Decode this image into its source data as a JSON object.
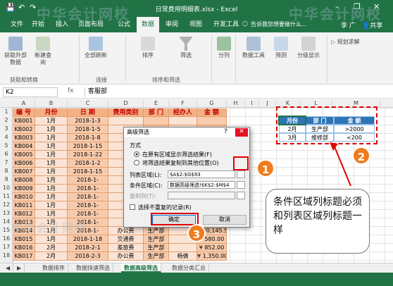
{
  "window": {
    "title": "日常费用明细表.xlsx - Excel",
    "minimize": "–",
    "restore": "❐",
    "close": "✕"
  },
  "menubar": {
    "tabs": [
      "文件",
      "开始",
      "插入",
      "页面布局",
      "公式",
      "数据",
      "审阅",
      "视图",
      "开发工具"
    ],
    "active": "数据",
    "tell_me": "告诉我您想要做什么...",
    "user": "李 广",
    "share": "共享"
  },
  "ribbon": {
    "groups": [
      {
        "label": "获取和转换",
        "buttons": [
          "获取外部数据",
          "新建查询"
        ]
      },
      {
        "label": "连接",
        "buttons": [
          "全部刷新"
        ]
      },
      {
        "label": "排序和筛选",
        "buttons": [
          "排序",
          "筛选"
        ]
      },
      {
        "label": "",
        "buttons": [
          "分列"
        ]
      },
      {
        "label": "",
        "buttons": [
          "数据工具",
          "预测",
          "分级显示"
        ]
      }
    ],
    "planning": "规划求解"
  },
  "formula": {
    "name_box": "K2",
    "fx": "fx",
    "value": "客服部"
  },
  "columns": [
    "A",
    "B",
    "C",
    "D",
    "E",
    "F",
    "G",
    "H",
    "I",
    "J",
    "K",
    "L",
    "M"
  ],
  "rows": [
    "1",
    "2",
    "3",
    "4",
    "5",
    "6",
    "7",
    "8",
    "9",
    "10",
    "11",
    "12",
    "13",
    "14",
    "15",
    "16",
    "17",
    "18"
  ],
  "table": {
    "headers": [
      "编 号",
      "月份",
      "日 期",
      "费用类别",
      "部 门",
      "经办人",
      "金 额"
    ],
    "rows": [
      [
        "KB001",
        "1月",
        "2018-1-3",
        "",
        "",
        "",
        ""
      ],
      [
        "KB002",
        "1月",
        "2018-1-5",
        "",
        "",
        "",
        ""
      ],
      [
        "KB003",
        "1月",
        "2018-1-8",
        "",
        "",
        "",
        ""
      ],
      [
        "KB004",
        "1月",
        "2018-1-15",
        "",
        "",
        "",
        ""
      ],
      [
        "KB005",
        "1月",
        "2018-1-22",
        "",
        "",
        "",
        ""
      ],
      [
        "KB006",
        "1月",
        "2018-1-2",
        "",
        "",
        "",
        ""
      ],
      [
        "KB007",
        "1月",
        "2018-1-15",
        "",
        "",
        "",
        ""
      ],
      [
        "KB008",
        "1月",
        "2018-1-",
        "",
        "",
        "",
        ""
      ],
      [
        "KB009",
        "1月",
        "2018-1-",
        "",
        "",
        "",
        ""
      ],
      [
        "KB010",
        "1月",
        "2018-1-",
        "",
        "",
        "",
        ""
      ],
      [
        "KB011",
        "1月",
        "2018-1-",
        "",
        "",
        "",
        ""
      ],
      [
        "KB012",
        "1月",
        "2018-1-",
        "",
        "",
        "",
        ""
      ],
      [
        "KB013",
        "1月",
        "2018-1-",
        "",
        "",
        "",
        ""
      ],
      [
        "KB014",
        "1月",
        "2018-1-",
        "办公费",
        "生产部",
        "",
        "¥ 20,145.50"
      ],
      [
        "KB015",
        "1月",
        "2018-1-18",
        "交通费",
        "生产部",
        "",
        "¥ 580.00"
      ],
      [
        "KB016",
        "2月",
        "2018-2-1",
        "差旅费",
        "生产部",
        "",
        "¥ 852.00"
      ],
      [
        "KB017",
        "2月",
        "2018-2-3",
        "办公费",
        "生产部",
        "杨倩",
        "¥ 1,350.00"
      ]
    ]
  },
  "criteria": {
    "headers": [
      "月份",
      "部 门",
      "金 额"
    ],
    "rows": [
      [
        "2月",
        "生产部",
        ">2000"
      ],
      [
        "3月",
        "维修部",
        "<200"
      ]
    ]
  },
  "dialog": {
    "title": "高级筛选",
    "question": "?",
    "close": "✕",
    "method_label": "方式",
    "radio1": "在原有区域显示筛选结果(F)",
    "radio2": "将筛选结果复制到其他位置(O)",
    "list_label": "列表区域(L):",
    "list_value": "$A$2:$G$93",
    "crit_label": "条件区域(C):",
    "crit_value": "数据高级筛选!$K$2:$M$4",
    "copy_label": "复制到(T):",
    "copy_value": "",
    "unique_label": "选择不重复的记录(R)",
    "ok": "确定",
    "cancel": "取消"
  },
  "callouts": {
    "b1": "1",
    "b2": "2",
    "b3": "3",
    "note": "条件区域列标题必须和列表区域列标题一样"
  },
  "sheet_tabs": [
    "数据排序",
    "数据快速筛选",
    "数据高级筛选",
    "数据分类汇总"
  ],
  "active_sheet": "数据高级筛选",
  "watermark": "中华会计网校",
  "colors": {
    "excel_green": "#217346",
    "header_fill": "#f4b183",
    "body_fill": "#f8cbad",
    "crit_header": "#2e75b6",
    "callout": "#f07c1f",
    "highlight": "#e00000"
  }
}
